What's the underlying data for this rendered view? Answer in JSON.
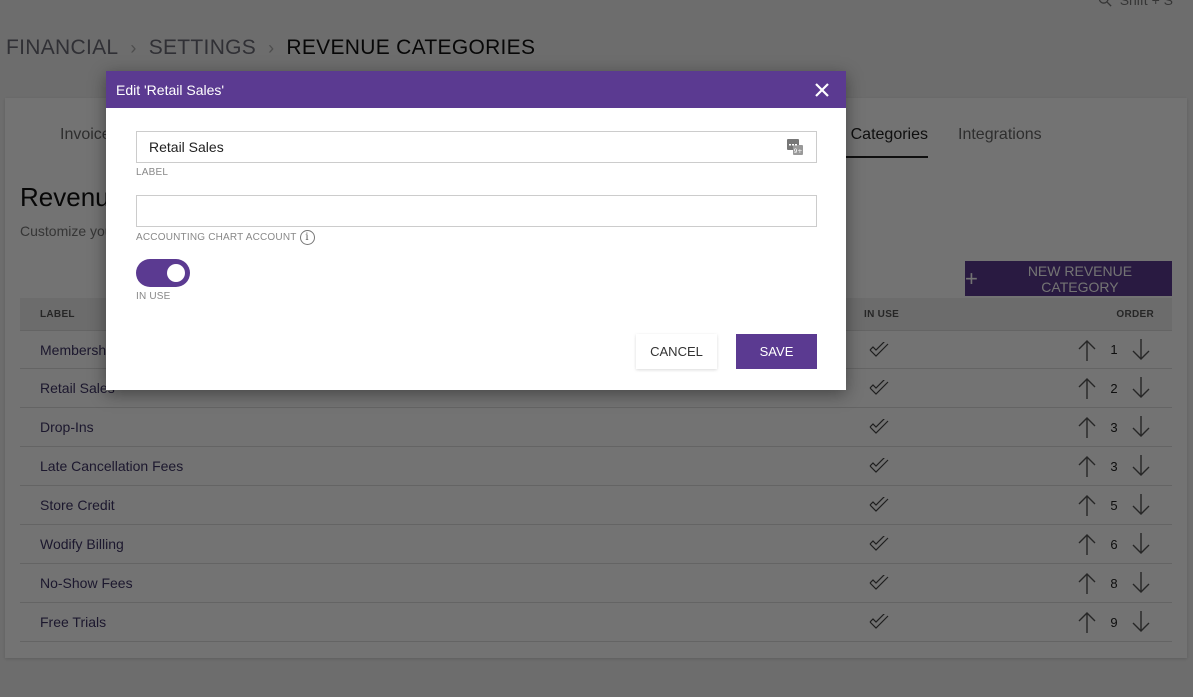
{
  "topbar": {
    "search_shortcut": "Shift + S"
  },
  "breadcrumb": {
    "items": [
      "FINANCIAL",
      "SETTINGS",
      "REVENUE CATEGORIES"
    ],
    "separator": "›"
  },
  "tabs": [
    {
      "label": "Invoices"
    },
    {
      "label": "Revenue Categories",
      "active": true
    },
    {
      "label": "Integrations"
    }
  ],
  "section": {
    "title": "Revenue Categories",
    "description": "Customize your revenue categories"
  },
  "new_button": {
    "label": "NEW REVENUE CATEGORY",
    "icon": "plus-icon"
  },
  "table": {
    "columns": {
      "label": "LABEL",
      "in_use": "IN USE",
      "order": "ORDER"
    },
    "rows": [
      {
        "label": "Memberships",
        "in_use": true,
        "order": "1"
      },
      {
        "label": "Retail Sales",
        "in_use": true,
        "order": "2"
      },
      {
        "label": "Drop-Ins",
        "in_use": true,
        "order": "3"
      },
      {
        "label": "Late Cancellation Fees",
        "in_use": true,
        "order": "3"
      },
      {
        "label": "Store Credit",
        "in_use": true,
        "order": "5"
      },
      {
        "label": "Wodify Billing",
        "in_use": true,
        "order": "6"
      },
      {
        "label": "No-Show Fees",
        "in_use": true,
        "order": "8"
      },
      {
        "label": "Free Trials",
        "in_use": true,
        "order": "9"
      }
    ]
  },
  "modal": {
    "title": "Edit 'Retail Sales'",
    "close_icon": "close-icon",
    "label_field": {
      "value": "Retail Sales",
      "caption": "LABEL"
    },
    "account_field": {
      "value": "",
      "caption": "ACCOUNTING CHART ACCOUNT"
    },
    "toggle": {
      "caption": "IN USE",
      "on": true
    },
    "cancel_label": "CANCEL",
    "save_label": "SAVE"
  },
  "colors": {
    "brand": "#5b3a91",
    "overlay": "rgba(0,0,0,0.55)"
  }
}
